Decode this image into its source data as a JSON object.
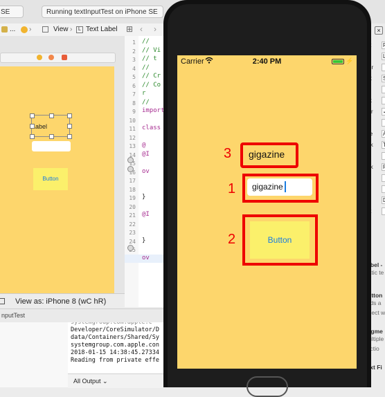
{
  "toolbar": {
    "scheme_label": "SE",
    "status_text": "Running textInputTest on iPhone SE"
  },
  "jumpbar": {
    "items": [
      "...",
      "View",
      "Text Label"
    ]
  },
  "storyboard": {
    "label_text": "Label",
    "button_text": "Button",
    "view_as": "View as: iPhone 8 (wC hR)"
  },
  "editor": {
    "line_numbers": [
      "1",
      "2",
      "3",
      "4",
      "5",
      "6",
      "7",
      "8",
      "9",
      "10",
      "11",
      "12",
      "13",
      "14",
      "15",
      "16",
      "17",
      "18",
      "19",
      "20",
      "21",
      "22",
      "23",
      "24",
      "25"
    ],
    "lines": [
      {
        "text": "//",
        "cls": "cm"
      },
      {
        "text": "//  Vi",
        "cls": "cm"
      },
      {
        "text": "//  t",
        "cls": "cm"
      },
      {
        "text": "//",
        "cls": "cm"
      },
      {
        "text": "//  Cr",
        "cls": "cm"
      },
      {
        "text": "//  Co",
        "cls": "cm"
      },
      {
        "text": "    r",
        "cls": "cm"
      },
      {
        "text": "//",
        "cls": "cm"
      },
      {
        "text": "import",
        "cls": "kw"
      },
      {
        "text": "",
        "cls": ""
      },
      {
        "text": "class",
        "cls": "kw"
      },
      {
        "text": "",
        "cls": ""
      },
      {
        "text": "  @",
        "cls": "kw"
      },
      {
        "text": "  @I",
        "cls": "kw"
      },
      {
        "text": "",
        "cls": ""
      },
      {
        "text": "  ov",
        "cls": "kw"
      },
      {
        "text": "",
        "cls": ""
      },
      {
        "text": "",
        "cls": ""
      },
      {
        "text": "  }",
        "cls": ""
      },
      {
        "text": "",
        "cls": ""
      },
      {
        "text": "  @I",
        "cls": "kw"
      },
      {
        "text": "",
        "cls": ""
      },
      {
        "text": "",
        "cls": ""
      },
      {
        "text": "  }",
        "cls": ""
      },
      {
        "text": "",
        "cls": ""
      },
      {
        "text": "  ov",
        "cls": "kw"
      }
    ],
    "current_line": "23"
  },
  "debug": {
    "target_label": "nputTest",
    "console_lines": [
      "Developer/CoreSimulator/D",
      "data/Containers/Shared/Sy",
      "systemgroup.com.apple.con",
      "2018-01-15 14:38:45.27334",
      "Reading from private effe"
    ],
    "output_filter": "All Output ⌄"
  },
  "inspector": {
    "rows": [
      {
        "label": "ext",
        "value": "P"
      },
      {
        "label": "",
        "value": "L"
      },
      {
        "label": "olor",
        "value": ""
      },
      {
        "label": "ont",
        "value": "S"
      },
      {
        "label": "be",
        "value": ""
      },
      {
        "label": "ent",
        "value": ""
      },
      {
        "label": "vior",
        "value": "✓"
      },
      {
        "label": "",
        "value": ""
      },
      {
        "label": "line",
        "value": "A"
      },
      {
        "label": "eak",
        "value": "T"
      },
      {
        "label": "",
        "value": ""
      },
      {
        "label": "rink",
        "value": "F"
      },
      {
        "label": "",
        "value": ""
      },
      {
        "label": "",
        "value": ""
      },
      {
        "label": "ow",
        "value": "D"
      },
      {
        "label": "set",
        "value": ""
      }
    ],
    "lib_items": [
      {
        "title": "Label -",
        "sub": "static te"
      },
      {
        "title": "Button",
        "sub": "ends a"
      },
      {
        "title": "",
        "sub": "object w"
      },
      {
        "title": "Segme",
        "sub": "multiple"
      },
      {
        "title": "",
        "sub": "unctio"
      },
      {
        "title": "Text Fi",
        "sub": ""
      }
    ]
  },
  "simulator": {
    "carrier": "Carrier",
    "time": "2:40 PM",
    "label_text": "gigazine",
    "field_value": "gigazine",
    "button_text": "Button",
    "annotations": [
      "3",
      "1",
      "2"
    ]
  },
  "colors": {
    "view_bg": "#fdd66c",
    "button_bg": "#fbf06b",
    "button_text": "#1a7ce0",
    "annotation_red": "#ee0000"
  }
}
